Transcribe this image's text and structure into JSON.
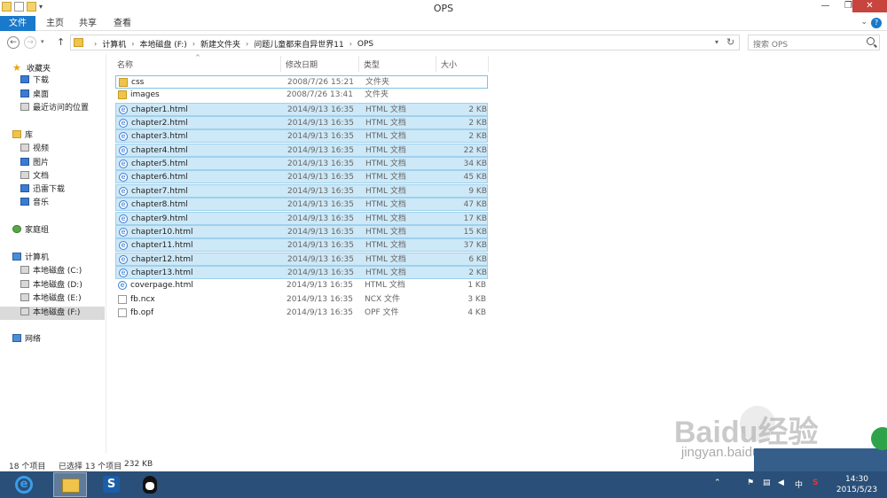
{
  "window": {
    "title": "OPS",
    "controls": {
      "minimize": "—",
      "maximize": "❐",
      "close": "✕"
    }
  },
  "ribbon": {
    "tabs": [
      "文件",
      "主页",
      "共享",
      "查看"
    ],
    "help": "?"
  },
  "address": {
    "crumbs": [
      "计算机",
      "本地磁盘 (F:)",
      "新建文件夹",
      "问题儿童都来自异世界11",
      "OPS"
    ],
    "search_placeholder": "搜索 OPS"
  },
  "nav": {
    "favorites": {
      "label": "收藏夹",
      "items": [
        "下载",
        "桌面",
        "最近访问的位置"
      ]
    },
    "library": {
      "label": "库",
      "items": [
        "视频",
        "图片",
        "文档",
        "迅雷下载",
        "音乐"
      ]
    },
    "homegroup": "家庭组",
    "computer": {
      "label": "计算机",
      "items": [
        "本地磁盘 (C:)",
        "本地磁盘 (D:)",
        "本地磁盘 (E:)",
        "本地磁盘 (F:)"
      ]
    },
    "network": "网络"
  },
  "columns": {
    "name": "名称",
    "date": "修改日期",
    "type": "类型",
    "size": "大小"
  },
  "files": [
    {
      "name": "css",
      "date": "2008/7/26 15:21",
      "type": "文件夹",
      "size": "",
      "icon": "folder",
      "selected": false
    },
    {
      "name": "images",
      "date": "2008/7/26 13:41",
      "type": "文件夹",
      "size": "",
      "icon": "folder",
      "selected": false
    },
    {
      "name": "chapter1.html",
      "date": "2014/9/13 16:35",
      "type": "HTML 文档",
      "size": "2 KB",
      "icon": "html",
      "selected": true
    },
    {
      "name": "chapter2.html",
      "date": "2014/9/13 16:35",
      "type": "HTML 文档",
      "size": "2 KB",
      "icon": "html",
      "selected": true
    },
    {
      "name": "chapter3.html",
      "date": "2014/9/13 16:35",
      "type": "HTML 文档",
      "size": "2 KB",
      "icon": "html",
      "selected": true
    },
    {
      "name": "chapter4.html",
      "date": "2014/9/13 16:35",
      "type": "HTML 文档",
      "size": "22 KB",
      "icon": "html",
      "selected": true
    },
    {
      "name": "chapter5.html",
      "date": "2014/9/13 16:35",
      "type": "HTML 文档",
      "size": "34 KB",
      "icon": "html",
      "selected": true
    },
    {
      "name": "chapter6.html",
      "date": "2014/9/13 16:35",
      "type": "HTML 文档",
      "size": "45 KB",
      "icon": "html",
      "selected": true
    },
    {
      "name": "chapter7.html",
      "date": "2014/9/13 16:35",
      "type": "HTML 文档",
      "size": "9 KB",
      "icon": "html",
      "selected": true
    },
    {
      "name": "chapter8.html",
      "date": "2014/9/13 16:35",
      "type": "HTML 文档",
      "size": "47 KB",
      "icon": "html",
      "selected": true
    },
    {
      "name": "chapter9.html",
      "date": "2014/9/13 16:35",
      "type": "HTML 文档",
      "size": "17 KB",
      "icon": "html",
      "selected": true
    },
    {
      "name": "chapter10.html",
      "date": "2014/9/13 16:35",
      "type": "HTML 文档",
      "size": "15 KB",
      "icon": "html",
      "selected": true
    },
    {
      "name": "chapter11.html",
      "date": "2014/9/13 16:35",
      "type": "HTML 文档",
      "size": "37 KB",
      "icon": "html",
      "selected": true
    },
    {
      "name": "chapter12.html",
      "date": "2014/9/13 16:35",
      "type": "HTML 文档",
      "size": "6 KB",
      "icon": "html",
      "selected": true
    },
    {
      "name": "chapter13.html",
      "date": "2014/9/13 16:35",
      "type": "HTML 文档",
      "size": "2 KB",
      "icon": "html",
      "selected": true
    },
    {
      "name": "coverpage.html",
      "date": "2014/9/13 16:35",
      "type": "HTML 文档",
      "size": "1 KB",
      "icon": "html",
      "selected": false
    },
    {
      "name": "fb.ncx",
      "date": "2014/9/13 16:35",
      "type": "NCX 文件",
      "size": "3 KB",
      "icon": "plain",
      "selected": false
    },
    {
      "name": "fb.opf",
      "date": "2014/9/13 16:35",
      "type": "OPF 文件",
      "size": "4 KB",
      "icon": "plain",
      "selected": false
    }
  ],
  "status": {
    "count": "18 个项目",
    "selected": "已选择 13 个项目",
    "size": "232 KB"
  },
  "taskbar": {
    "tray": {
      "ime": "中",
      "sogou": "S"
    },
    "clock": {
      "time": "14:30",
      "date": "2015/5/23"
    }
  },
  "watermark": {
    "brand": "Baidu经验",
    "url": "jingyan.baidu.com"
  },
  "colors": {
    "accent": "#1979ca",
    "selection": "#cde8f7",
    "taskbar": "#2a4f78",
    "close": "#c7453c"
  }
}
